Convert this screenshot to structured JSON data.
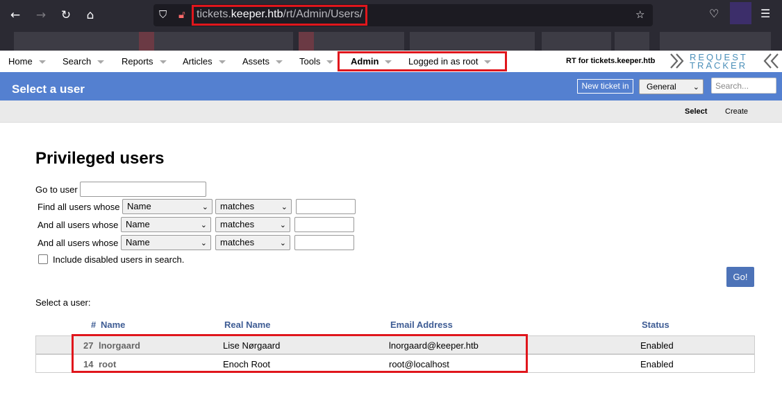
{
  "browser": {
    "url_domain_prefix": "tickets.",
    "url_domain_main": "keeper.htb",
    "url_path": "/rt/Admin/Users/"
  },
  "menu": {
    "items": [
      "Home",
      "Search",
      "Reports",
      "Articles",
      "Assets",
      "Tools",
      "Admin",
      "Logged in as root"
    ],
    "rt_for": "RT for tickets.keeper.htb",
    "logo_top": "REQUEST",
    "logo_bottom": "TRACKER"
  },
  "header": {
    "title": "Select a user",
    "new_ticket_label": "New ticket in",
    "queue_value": "General",
    "search_placeholder": "Search..."
  },
  "subnav": {
    "select_label": "Select",
    "create_label": "Create"
  },
  "main": {
    "title": "Privileged users",
    "go_to_user_label": "Go to user",
    "filters": [
      {
        "label": "Find all users whose",
        "field": "Name",
        "op": "matches"
      },
      {
        "label": "And all users whose",
        "field": "Name",
        "op": "matches"
      },
      {
        "label": "And all users whose",
        "field": "Name",
        "op": "matches"
      }
    ],
    "include_disabled_label": "Include disabled users in search.",
    "go_label": "Go!",
    "select_user_label": "Select a user:"
  },
  "table": {
    "headers": {
      "hash": "#",
      "name": "Name",
      "real_name": "Real Name",
      "email": "Email Address",
      "status": "Status"
    },
    "rows": [
      {
        "id": "27",
        "name": "lnorgaard",
        "real_name": "Lise Nørgaard",
        "email": "lnorgaard@keeper.htb",
        "status": "Enabled"
      },
      {
        "id": "14",
        "name": "root",
        "real_name": "Enoch Root",
        "email": "root@localhost",
        "status": "Enabled"
      }
    ]
  },
  "colors": {
    "header_blue": "#5480d0",
    "highlight_red": "#e0161c",
    "link_blue": "#3e5c94"
  }
}
